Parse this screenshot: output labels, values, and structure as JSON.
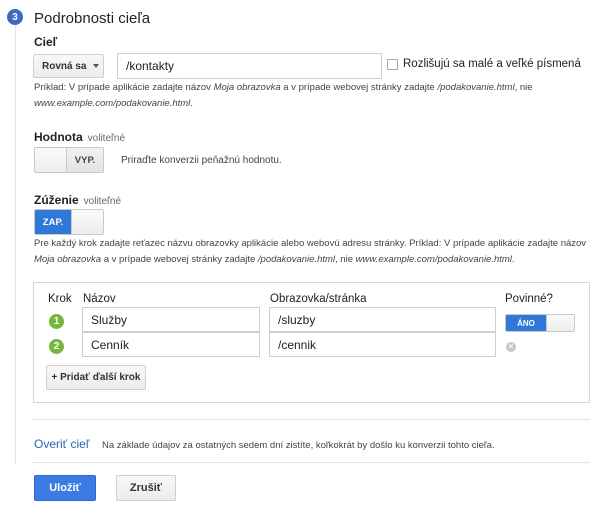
{
  "section": {
    "step_number": "3",
    "title": "Podrobnosti cieľa"
  },
  "goal": {
    "label": "Cieľ",
    "match_type": "Rovná sa",
    "value": "/kontakty",
    "case_sensitive_label": "Rozlišujú sa malé a veľké písmená",
    "case_sensitive_checked": false,
    "hint_parts": [
      "Príklad: V prípade aplikácie zadajte názov ",
      "Moja obrazovka",
      " a v prípade webovej stránky zadajte ",
      "/podakovanie.html",
      ", nie",
      "www.example.com/podakovanie.html",
      "."
    ]
  },
  "value_section": {
    "label": "Hodnota",
    "optional": "voliteľné",
    "toggle_label": "VYP.",
    "toggle_on": false,
    "description": "Priraďte konverzii peňažnú hodnotu."
  },
  "funnel": {
    "label": "Zúženie",
    "optional": "voliteľné",
    "toggle_label": "ZAP.",
    "toggle_on": true,
    "hint_parts": [
      "Pre každý krok zadajte reťazec názvu obrazovky aplikácie alebo webovú adresu stránky. Príklad: V prípade aplikácie zadajte názov",
      "Moja obrazovka",
      " a v prípade webovej stránky zadajte ",
      "/podakovanie.html",
      ", nie ",
      "www.example.com/podakovanie.html",
      "."
    ],
    "headers": {
      "step": "Krok",
      "name": "Názov",
      "screen": "Obrazovka/stránka",
      "required": "Povinné?"
    },
    "steps": [
      {
        "number": "1",
        "name": "Služby",
        "screen": "/sluzby",
        "required_label": "ÁNO"
      },
      {
        "number": "2",
        "name": "Cenník",
        "screen": "/cennik"
      }
    ],
    "add_step_label": "+ Pridať ďalší krok"
  },
  "verify": {
    "link": "Overiť cieľ",
    "description": "Na základe údajov za ostatných sedem dní zistíte, koľkokrát by došlo ku konverzii tohto cieľa."
  },
  "actions": {
    "save": "Uložiť",
    "cancel": "Zrušiť"
  },
  "colors": {
    "accent": "#3c7be3",
    "toggle_on": "#2f78d8",
    "step_green": "#76b83c",
    "link": "#2a64b7"
  }
}
